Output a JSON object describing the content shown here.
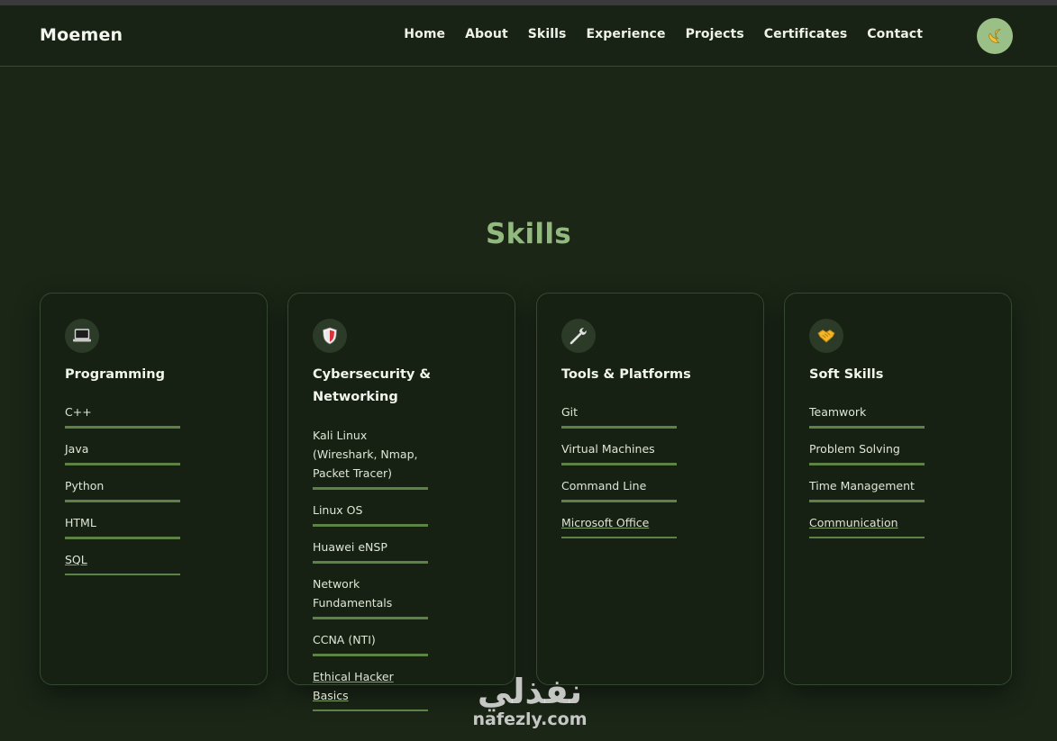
{
  "nav": {
    "brand": "Moemen",
    "links": [
      "Home",
      "About",
      "Skills",
      "Experience",
      "Projects",
      "Certificates",
      "Contact"
    ],
    "theme_icon": "moon-icon"
  },
  "section": {
    "title": "Skills"
  },
  "cards": [
    {
      "icon": "laptop-icon",
      "title": "Programming",
      "skills": [
        "C++",
        "Java",
        "Python",
        "HTML",
        "SQL"
      ]
    },
    {
      "icon": "shield-icon",
      "title": "Cybersecurity & Networking",
      "skills": [
        "Kali Linux (Wireshark, Nmap, Packet Tracer)",
        "Linux OS",
        "Huawei eNSP",
        "Network Fundamentals",
        "CCNA (NTI)",
        "Ethical Hacker Basics"
      ]
    },
    {
      "icon": "wrench-icon",
      "title": "Tools & Platforms",
      "skills": [
        "Git",
        "Virtual Machines",
        "Command Line",
        "Microsoft Office"
      ]
    },
    {
      "icon": "handshake-icon",
      "title": "Soft Skills",
      "skills": [
        "Teamwork",
        "Problem Solving",
        "Time Management",
        "Communication"
      ]
    }
  ],
  "watermark": {
    "arabic": "نفذلي",
    "latin": "nafezly.com"
  },
  "colors": {
    "accent": "#93ba7e",
    "background": "#1b2617",
    "underline": "#5c8246"
  }
}
